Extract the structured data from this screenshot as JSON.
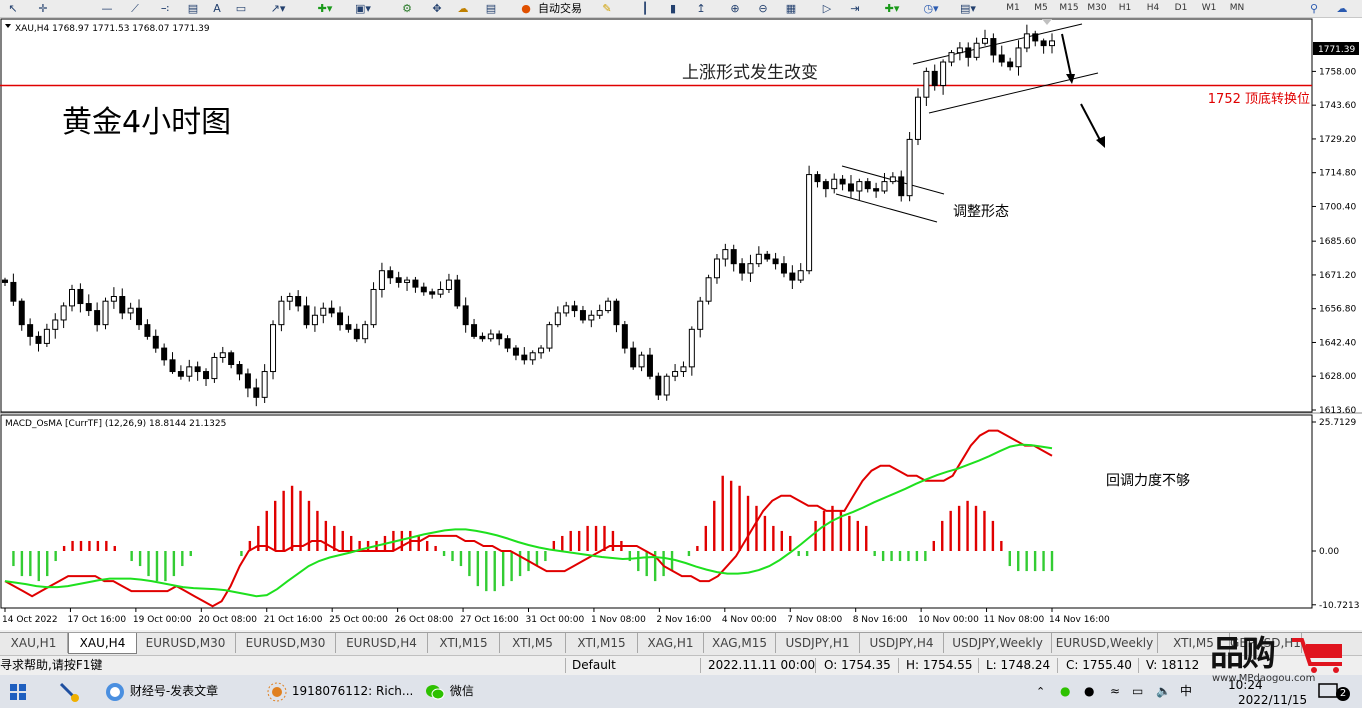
{
  "toolbar": {
    "autotrade_label": "自动交易",
    "timeframes": [
      "M1",
      "M5",
      "M15",
      "M30",
      "H1",
      "H4",
      "D1",
      "W1",
      "MN"
    ]
  },
  "header": {
    "symbol_info": "XAU,H4  1768.97 1771.53 1768.07 1771.39",
    "macd_info": "MACD_OsMA [CurrTF] (12,26,9) 18.8144 21.1325"
  },
  "annotations": {
    "main_title": "黄金4小时图",
    "form_change": "上涨形式发生改变",
    "consolidation": "调整形态",
    "weak_pullback": "回调力度不够",
    "support_label": "1752 顶底转换位"
  },
  "chart_data": [
    {
      "type": "candlestick",
      "title": "XAU,H4",
      "ylim": [
        1613.6,
        1790
      ],
      "y_ticks": [
        "1771.39",
        "1758.00",
        "1743.60",
        "1729.20",
        "1714.80",
        "1700.40",
        "1685.60",
        "1671.20",
        "1656.80",
        "1642.40",
        "1628.00",
        "1613.60"
      ],
      "x_ticks": [
        "14 Oct 2022",
        "17 Oct 16:00",
        "19 Oct 00:00",
        "20 Oct 08:00",
        "21 Oct 16:00",
        "25 Oct 00:00",
        "26 Oct 08:00",
        "27 Oct 16:00",
        "31 Oct 00:00",
        "1 Nov 08:00",
        "2 Nov 16:00",
        "4 Nov 00:00",
        "7 Nov 08:00",
        "8 Nov 16:00",
        "10 Nov 00:00",
        "11 Nov 08:00",
        "14 Nov 16:00"
      ],
      "current_price": "1771.39",
      "hline": {
        "value": 1752,
        "color": "#e00000"
      },
      "candle_colors": {
        "bull": "#ffffff",
        "bear": "#000000",
        "outline": "#000000"
      },
      "close": [
        1668,
        1660,
        1650,
        1645,
        1642,
        1648,
        1652,
        1658,
        1665,
        1659,
        1656,
        1650,
        1660,
        1662,
        1655,
        1657,
        1650,
        1645,
        1640,
        1635,
        1630,
        1628,
        1632,
        1630,
        1627,
        1636,
        1638,
        1633,
        1629,
        1623,
        1619,
        1630,
        1650,
        1660,
        1662,
        1658,
        1650,
        1654,
        1657,
        1655,
        1650,
        1648,
        1644,
        1650,
        1665,
        1673,
        1670,
        1668,
        1669,
        1666,
        1664,
        1663,
        1665,
        1669,
        1658,
        1650,
        1645,
        1644,
        1646,
        1644,
        1640,
        1637,
        1635,
        1638,
        1640,
        1650,
        1655,
        1658,
        1656,
        1652,
        1654,
        1656,
        1660,
        1650,
        1640,
        1632,
        1637,
        1628,
        1620,
        1628,
        1630,
        1632,
        1648,
        1660,
        1670,
        1678,
        1682,
        1676,
        1672,
        1676,
        1680,
        1678,
        1676,
        1672,
        1669,
        1673,
        1714,
        1711,
        1708,
        1712,
        1710,
        1707,
        1711,
        1708,
        1707,
        1711,
        1713,
        1705,
        1729,
        1747,
        1758,
        1752,
        1762,
        1766,
        1768,
        1764,
        1770,
        1772,
        1765,
        1762,
        1760,
        1768,
        1774,
        1771,
        1769,
        1771
      ]
    },
    {
      "type": "line",
      "title": "MACD_OsMA [CurrTF] (12,26,9)",
      "ylim": [
        -10.7213,
        25.7129
      ],
      "y_ticks": [
        "25.7129",
        "0.00",
        "-10.7213"
      ],
      "series": [
        {
          "name": "MACD",
          "color": "#e00000",
          "values": [
            -6,
            -7,
            -8,
            -9,
            -8,
            -7,
            -6,
            -5,
            -5,
            -5,
            -5,
            -6,
            -6,
            -7,
            -8,
            -8,
            -8,
            -8,
            -8,
            -7,
            -8,
            -9,
            -10,
            -11,
            -10,
            -7,
            -3,
            0,
            1,
            1,
            0,
            0,
            1,
            1,
            2,
            2,
            1,
            0,
            0,
            0,
            0,
            0,
            0,
            0,
            1,
            2,
            2,
            3,
            3,
            3,
            3,
            2,
            2,
            1,
            1,
            0,
            0,
            -1,
            -2,
            -3,
            -4,
            -4,
            -4,
            -3,
            -2,
            -1,
            0,
            1,
            1,
            1,
            1,
            0,
            -1,
            -3,
            -4,
            -5,
            -5,
            -6,
            -6,
            -5,
            -3,
            -1,
            2,
            5,
            8,
            10,
            11,
            11,
            10,
            9,
            9,
            8,
            8,
            8,
            11,
            14,
            16,
            17,
            17,
            16,
            15,
            15,
            14,
            14,
            14,
            15,
            18,
            21,
            23,
            24,
            24,
            23,
            22,
            21,
            21,
            20,
            19
          ]
        },
        {
          "name": "Signal",
          "color": "#1ee01e",
          "values": [
            -6,
            -6.3,
            -6.6,
            -7,
            -7.2,
            -7.2,
            -7,
            -6.6,
            -6.2,
            -5.8,
            -5.5,
            -5.5,
            -5.5,
            -5.7,
            -6,
            -6.4,
            -6.8,
            -7.2,
            -7.4,
            -7.5,
            -7.6,
            -7.8,
            -8.2,
            -8.6,
            -9,
            -8.8,
            -7.6,
            -6,
            -4.5,
            -3,
            -2,
            -1.3,
            -0.8,
            -0.3,
            0.3,
            0.8,
            1.3,
            1.8,
            2.3,
            2.8,
            3.3,
            3.7,
            4.1,
            4.3,
            4.3,
            4,
            3.6,
            3.1,
            2.5,
            1.8,
            1.2,
            0.7,
            0.3,
            0,
            -0.3,
            -0.6,
            -0.9,
            -1.2,
            -1.4,
            -1.6,
            -1.5,
            -1.3,
            -1.2,
            -1.4,
            -1.8,
            -2.4,
            -3.1,
            -3.7,
            -4.2,
            -4.5,
            -4.5,
            -4.3,
            -3.8,
            -3,
            -1.8,
            -0.3,
            1.3,
            3,
            4.7,
            6,
            7,
            7.8,
            8.7,
            9.7,
            10.6,
            11.5,
            12.4,
            13.4,
            14.3,
            15.1,
            15.8,
            16.4,
            17.2,
            18,
            18.9,
            19.9,
            20.8,
            21.2,
            21.1,
            20.8,
            20.5
          ]
        }
      ],
      "histogram": {
        "color_pos": "#e00000",
        "color_neg": "#33cc33",
        "values": [
          0,
          -3,
          -5,
          -5,
          -6,
          -5,
          -2,
          1,
          2,
          2,
          2,
          2,
          2,
          1,
          0,
          -2,
          -3,
          -5,
          -6,
          -6,
          -5,
          -3,
          -1,
          0,
          0,
          0,
          0,
          0,
          -1,
          2,
          5,
          8,
          10,
          12,
          13,
          12,
          10,
          8,
          6,
          5,
          4,
          3,
          2,
          2,
          2,
          3,
          4,
          4,
          4,
          3,
          2,
          1,
          -1,
          -2,
          -3,
          -5,
          -7,
          -8,
          -8,
          -7,
          -6,
          -5,
          -4,
          -3,
          -2,
          2,
          3,
          4,
          4,
          5,
          5,
          5,
          4,
          2,
          -2,
          -4,
          -5,
          -6,
          -5,
          -4,
          0,
          -1,
          1,
          5,
          10,
          15,
          14,
          13,
          11,
          9,
          7,
          5,
          4,
          3,
          -1,
          -1,
          6,
          8,
          9,
          8,
          7,
          6,
          5,
          -1,
          -2,
          -2,
          -2,
          -2,
          -2,
          -2,
          2,
          6,
          8,
          9,
          10,
          9,
          8,
          6,
          2,
          -3,
          -4,
          -4,
          -4,
          -4,
          -4
        ]
      }
    }
  ],
  "tabs": [
    "XAU,H1",
    "XAU,H4",
    "EURUSD,M30",
    "EURUSD,M30",
    "EURUSD,H4",
    "XTI,M15",
    "XTI,M5",
    "XTI,M15",
    "XAG,H1",
    "XAG,M15",
    "USDJPY,H1",
    "USDJPY,H4",
    "USDJPY,Weekly",
    "EURUSD,Weekly",
    "XTI,M5",
    "GBPUSD,H1"
  ],
  "active_tab": 1,
  "status": {
    "help": "寻求帮助,请按F1键",
    "profile": "Default",
    "datetime": "2022.11.11 00:00",
    "open": "O: 1754.35",
    "high": "H: 1754.55",
    "low": "L: 1748.24",
    "close": "C: 1755.40",
    "volume": "V: 18112"
  },
  "taskbar": {
    "items": [
      "财经号-发表文章",
      "1918076112: Rich...",
      "微信"
    ],
    "time": "10:24",
    "date": "2022/11/15",
    "notification_count": "2"
  },
  "watermark": {
    "text": "品购",
    "url": "www.MPdaogou.com"
  }
}
